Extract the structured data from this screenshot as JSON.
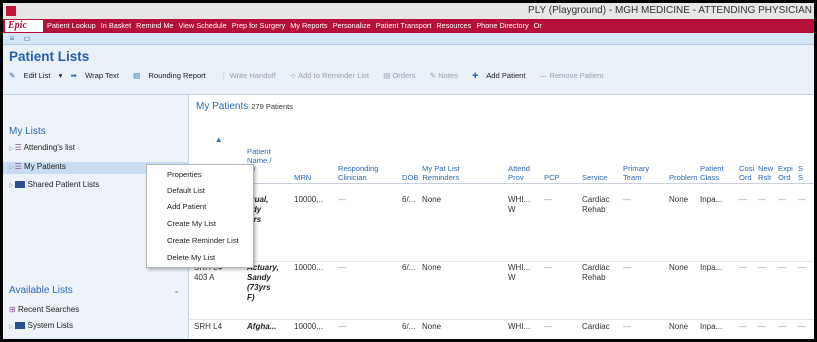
{
  "window": {
    "title": "PLY (Playground) - MGH MEDICINE - ATTENDING PHYSICIAN"
  },
  "epic_bar": {
    "logo": "Epic",
    "menu": [
      "Patient Lookup",
      "In Basket",
      "Remind Me",
      "View Schedule",
      "Prep for Surgery",
      "My Reports",
      "Personalize",
      "Patient Transport",
      "Resources",
      "Phone Directory",
      "Or"
    ]
  },
  "page": {
    "title": "Patient Lists"
  },
  "toolbar": {
    "edit_list": "Edit List",
    "wrap_text": "Wrap Text",
    "rounding_report": "Rounding Report",
    "write_handoff": "Write Handoff",
    "add_reminder": "Add to Reminder List",
    "orders": "Orders",
    "notes": "Notes",
    "add_patient": "Add Patient",
    "remove_patient": "Remove Patient"
  },
  "sidebar": {
    "my_lists_header": "My Lists",
    "items": [
      "Attending's list",
      "My Patients",
      "Shared Patient Lists"
    ],
    "available_header": "Available Lists",
    "available_items": [
      "Recent Searches",
      "System Lists"
    ]
  },
  "context_menu": [
    "Properties",
    "Default List",
    "Add Patient",
    "Create My List",
    "Create Reminder List",
    "Delete My List"
  ],
  "main": {
    "title": "My Patients",
    "count": "279 Patients",
    "columns": {
      "name": [
        "Patient",
        "Name /",
        "e /",
        "x"
      ],
      "mrn": "MRN",
      "clinician": [
        "Responding",
        "Clinician"
      ],
      "dob": "DOB",
      "reminders": [
        "My Pat List",
        "Reminders"
      ],
      "attend": [
        "Attend",
        "Prov"
      ],
      "pcp": "PCP",
      "service": "Service",
      "team": [
        "Primary",
        "Team"
      ],
      "problem": "Problem",
      "class": [
        "Patient",
        "Class"
      ],
      "cosi": [
        "Cosi",
        "Ord"
      ],
      "new": [
        "New",
        "Rslt"
      ],
      "expi": [
        "Expi",
        "Ord"
      ],
      "s": [
        "S",
        "S"
      ]
    },
    "rows": [
      {
        "room": [
          "",
          ""
        ],
        "name": [
          "crual,",
          "ndy",
          "lyrs"
        ],
        "mrn": "10000...",
        "clinician": "—",
        "dob": "6/...",
        "reminders": "None",
        "attend": [
          "WHI...",
          "W"
        ],
        "pcp": "—",
        "service": [
          "Cardiac",
          "Rehab"
        ],
        "team": "—",
        "problem": "None",
        "class": "Inpa...",
        "dashes": "—"
      },
      {
        "room": [
          "SRH L4",
          "403 A"
        ],
        "name": [
          "Actuary,",
          "Sandy",
          "(73yrs",
          "F)"
        ],
        "mrn": "10000...",
        "clinician": "—",
        "dob": "6/...",
        "reminders": "None",
        "attend": [
          "WHI...",
          "W"
        ],
        "pcp": "—",
        "service": [
          "Cardiac",
          "Rehab"
        ],
        "team": "—",
        "problem": "None",
        "class": "Inpa...",
        "dashes": "—"
      },
      {
        "room": [
          "SRH L4",
          ""
        ],
        "name": [
          "Afgha...",
          "",
          ""
        ],
        "mrn": "10000...",
        "clinician": "—",
        "dob": "6/...",
        "reminders": "None",
        "attend": [
          "WHI...",
          ""
        ],
        "pcp": "—",
        "service": [
          "Cardiac",
          ""
        ],
        "team": "—",
        "problem": "None",
        "class": "Inpa...",
        "dashes": "—"
      }
    ]
  }
}
